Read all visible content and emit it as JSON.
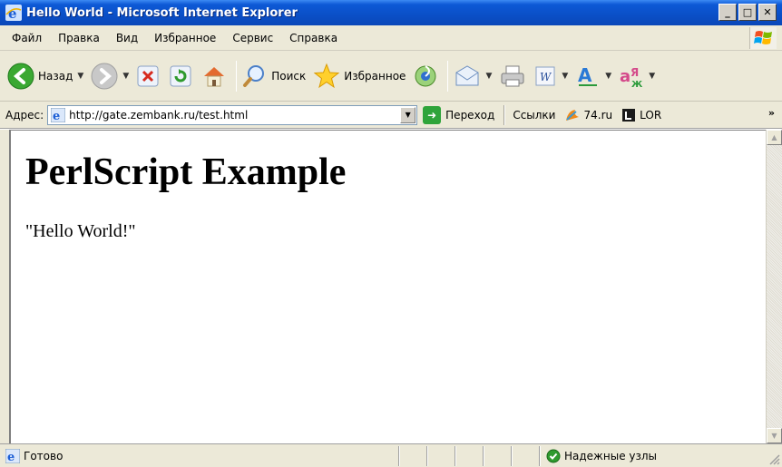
{
  "window": {
    "title": "Hello World - Microsoft Internet Explorer",
    "buttons": {
      "minimize": "_",
      "maximize": "□",
      "close": "✕"
    }
  },
  "menu": {
    "items": [
      {
        "label": "Файл"
      },
      {
        "label": "Правка"
      },
      {
        "label": "Вид"
      },
      {
        "label": "Избранное"
      },
      {
        "label": "Сервис"
      },
      {
        "label": "Справка"
      }
    ]
  },
  "toolbar": {
    "back_label": "Назад",
    "search_label": "Поиск",
    "favorites_label": "Избранное"
  },
  "address": {
    "label": "Адрес:",
    "url": "http://gate.zembank.ru/test.html",
    "go_label": "Переход",
    "links_label": "Ссылки",
    "links": [
      {
        "label": "74.ru"
      },
      {
        "label": "LOR"
      }
    ]
  },
  "page": {
    "heading": "PerlScript Example",
    "text": "\"Hello World!\""
  },
  "status": {
    "text": "Готово",
    "zone": "Надежные узлы"
  },
  "colors": {
    "titlebar": "#0a4fc7",
    "chrome": "#ece9d8",
    "go_green": "#2fa43b"
  }
}
